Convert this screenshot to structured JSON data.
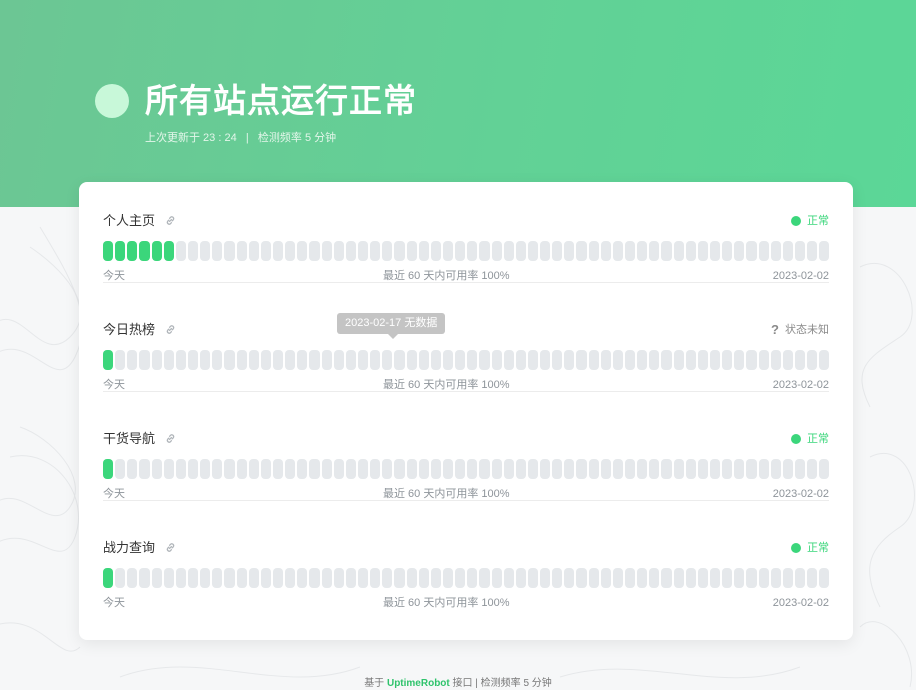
{
  "header": {
    "title": "所有站点运行正常",
    "subtitle": "上次更新于 23 : 24   |   检测频率 5 分钟"
  },
  "colors": {
    "up": "#3bd67b",
    "unknown_bar": "#e5e8eb",
    "hero_start": "#6cc694",
    "hero_end": "#5bd797"
  },
  "bar_count": 60,
  "monitors": [
    {
      "name": "个人主页",
      "status_icon": "green-dot",
      "status": "正常",
      "status_color": "#3bd67b",
      "up_days": 6,
      "foot_left": "今天",
      "foot_mid": "最近 60 天内可用率 100%",
      "foot_right": "2023-02-02"
    },
    {
      "name": "今日热榜",
      "status_icon": "question-mark",
      "status": "状态未知",
      "status_color": "#8a8a8a",
      "up_days": 1,
      "foot_left": "今天",
      "foot_mid": "最近 60 天内可用率 100%",
      "foot_right": "2023-02-02"
    },
    {
      "name": "干货导航",
      "status_icon": "green-dot",
      "status": "正常",
      "status_color": "#3bd67b",
      "up_days": 1,
      "foot_left": "今天",
      "foot_mid": "最近 60 天内可用率 100%",
      "foot_right": "2023-02-02"
    },
    {
      "name": "战力查询",
      "status_icon": "green-dot",
      "status": "正常",
      "status_color": "#3bd67b",
      "up_days": 1,
      "foot_left": "今天",
      "foot_mid": "最近 60 天内可用率 100%",
      "foot_right": "2023-02-02"
    }
  ],
  "tooltip": {
    "text": "2023-02-17 无数据"
  },
  "footer": {
    "prefix": "基于",
    "link": "UptimeRobot",
    "suffix": "接口 | 检测频率 5 分钟"
  }
}
